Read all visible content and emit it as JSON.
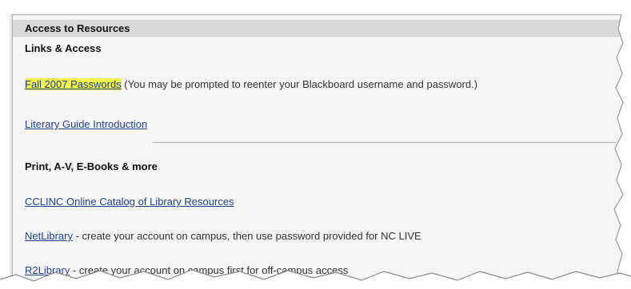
{
  "panel": {
    "title": "Access to Resources"
  },
  "links_access": {
    "heading": "Links & Access",
    "passwords_link": "Fall 2007 Passwords",
    "passwords_note": " (You may be prompted to reenter your Blackboard username and password.)",
    "literary_link": "Literary Guide Introduction"
  },
  "print_av": {
    "heading": "Print, A-V, E-Books & more",
    "catalog_link": "CCLINC Online Catalog of Library Resources",
    "netlibrary_link": "NetLibrary",
    "netlibrary_note": " - create your account on campus, then use password provided for NC LIVE",
    "r2library_link": "R2Library",
    "r2library_note": " - create your account on campus first for off-campus access"
  },
  "colors": {
    "link": "#1f3f8f",
    "highlight": "#f2f24a",
    "header_bg": "#d9d9d9",
    "panel_bg": "#f5f5f5"
  }
}
